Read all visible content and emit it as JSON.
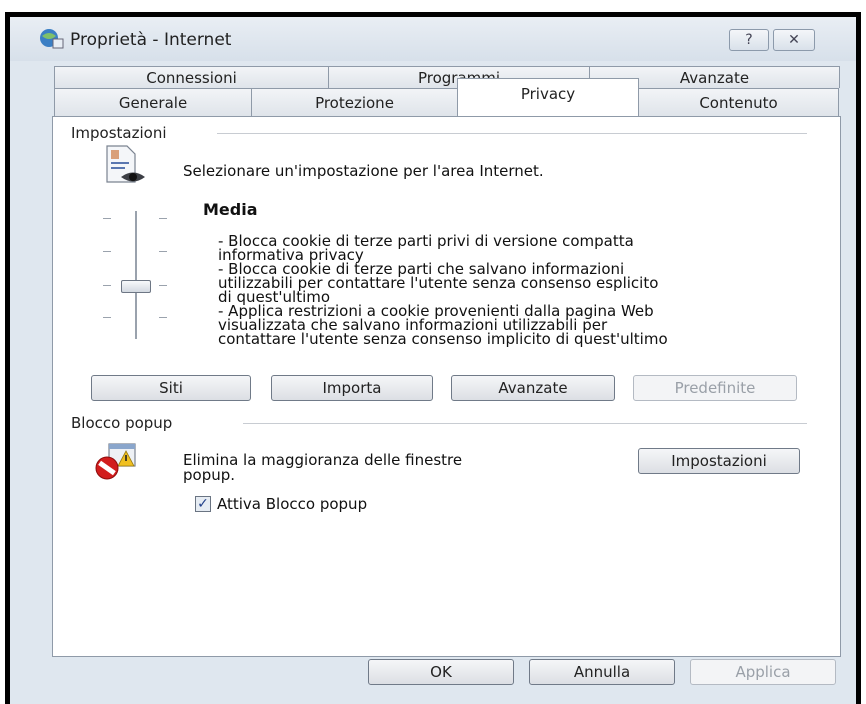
{
  "window": {
    "title": "Proprietà - Internet",
    "help_glyph": "?",
    "close_glyph": "✕"
  },
  "tabs": {
    "row1": [
      "Connessioni",
      "Programmi",
      "Avanzate"
    ],
    "row2": [
      "Generale",
      "Protezione",
      "Privacy",
      "Contenuto"
    ],
    "active": "Privacy"
  },
  "settings": {
    "group_label": "Impostazioni",
    "description": "Selezionare un'impostazione per l'area Internet.",
    "level": "Media",
    "lines": [
      "- Blocca cookie di terze parti privi di versione compatta",
      "informativa privacy",
      "- Blocca cookie di terze parti che salvano informazioni",
      "utilizzabili per contattare l'utente senza consenso esplicito",
      "di quest'ultimo",
      "- Applica restrizioni a cookie provenienti dalla pagina Web",
      "visualizzata che salvano informazioni utilizzabili per",
      "contattare l'utente senza consenso implicito di quest'ultimo"
    ],
    "buttons": {
      "sites": "Siti",
      "import": "Importa",
      "advanced": "Avanzate",
      "default": "Predefinite"
    }
  },
  "popup": {
    "group_label": "Blocco popup",
    "description_line1": "Elimina la maggioranza delle finestre",
    "description_line2": "popup.",
    "settings_button": "Impostazioni",
    "checkbox_label": "Attiva Blocco popup",
    "checkbox_checked": true
  },
  "footer": {
    "ok": "OK",
    "cancel": "Annulla",
    "apply": "Applica"
  }
}
